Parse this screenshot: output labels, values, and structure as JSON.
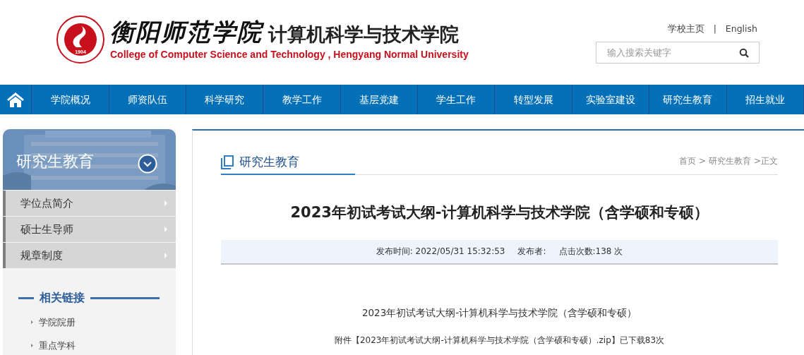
{
  "header": {
    "calligraphy": "衡阳师范学院",
    "college_name": "计算机科学与技术学院",
    "college_name_en": "College of Computer Science and Technology , Hengyang Normal University",
    "seal_year": "1904",
    "top_links": [
      "学校主页",
      "English"
    ],
    "top_link_separator": "|",
    "search": {
      "placeholder": "输入搜索关键字"
    }
  },
  "nav": {
    "items": [
      {
        "label": "学院概况",
        "selected": false
      },
      {
        "label": "师资队伍",
        "selected": false
      },
      {
        "label": "科学研究",
        "selected": false
      },
      {
        "label": "教学工作",
        "selected": false
      },
      {
        "label": "基层党建",
        "selected": false
      },
      {
        "label": "学生工作",
        "selected": false
      },
      {
        "label": "转型发展",
        "selected": false
      },
      {
        "label": "实验室建设",
        "selected": false
      },
      {
        "label": "研究生教育",
        "selected": false
      },
      {
        "label": "招生就业",
        "selected": false
      }
    ]
  },
  "sidebar": {
    "title": "研究生教育",
    "items": [
      "学位点简介",
      "硕士生导师",
      "规章制度"
    ],
    "links_title": "相关链接",
    "links": [
      "学院院册",
      "重点学科"
    ]
  },
  "content": {
    "column_title": "研究生教育",
    "breadcrumb": [
      "首页",
      ">",
      "研究生教育",
      ">正文"
    ],
    "article_title": "2023年初试考试大纲-计算机科学与技术学院（含学硕和专硕）",
    "meta": [
      "发布时间: 2022/05/31 15:32:53",
      "发布者:",
      "点击次数:138 次"
    ],
    "body": "2023年初试考试大纲-计算机科学与技术学院（含学硕和专硕）",
    "attachment_prefix": "附件【",
    "attachment_link": "2023年初试考试大纲-计算机科学与技术学院（含学硕和专硕）.zip",
    "attachment_suffix": "】已下载83次"
  }
}
